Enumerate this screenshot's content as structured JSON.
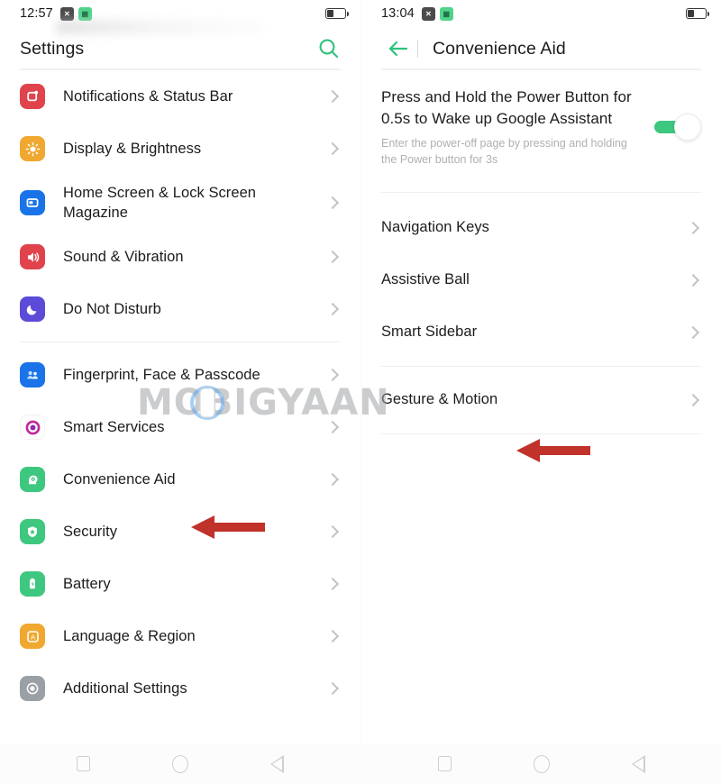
{
  "left_panel": {
    "status_bar": {
      "time": "12:57",
      "icons": [
        "app-icon-dark",
        "app-icon-green"
      ],
      "battery_level_percent": 38
    },
    "header": {
      "title": "Settings",
      "search_icon": "search-icon"
    },
    "list": [
      {
        "label": "Notifications & Status Bar",
        "icon": "bell-icon",
        "icon_color": "#e0434b",
        "chevron": "chevron-right-icon",
        "divider_after": false
      },
      {
        "label": "Display & Brightness",
        "icon": "brightness-icon",
        "icon_color": "#f0a830",
        "chevron": "chevron-right-icon",
        "divider_after": false
      },
      {
        "label": "Home Screen & Lock Screen Magazine",
        "icon": "home-screen-icon",
        "icon_color": "#1a73e8",
        "chevron": "chevron-right-icon",
        "divider_after": false
      },
      {
        "label": "Sound & Vibration",
        "icon": "speaker-icon",
        "icon_color": "#e0434b",
        "chevron": "chevron-right-icon",
        "divider_after": false
      },
      {
        "label": "Do Not Disturb",
        "icon": "moon-icon",
        "icon_color": "#5b4bd6",
        "chevron": "chevron-right-icon",
        "divider_after": true
      },
      {
        "label": "Fingerprint, Face & Passcode",
        "icon": "fingerprint-face-icon",
        "icon_color": "#1a73e8",
        "chevron": "chevron-right-icon",
        "divider_after": false
      },
      {
        "label": "Smart Services",
        "icon": "smart-services-icon",
        "icon_color": "#ffffff",
        "chevron": "chevron-right-icon",
        "divider_after": false
      },
      {
        "label": "Convenience Aid",
        "icon": "head-brain-icon",
        "icon_color": "#3ec77f",
        "chevron": "chevron-right-icon",
        "divider_after": false
      },
      {
        "label": "Security",
        "icon": "shield-icon",
        "icon_color": "#3ec77f",
        "chevron": "chevron-right-icon",
        "divider_after": false
      },
      {
        "label": "Battery",
        "icon": "battery-icon",
        "icon_color": "#3ec77f",
        "chevron": "chevron-right-icon",
        "divider_after": false
      },
      {
        "label": "Language & Region",
        "icon": "language-a-icon",
        "icon_color": "#f0a830",
        "chevron": "chevron-right-icon",
        "divider_after": false
      },
      {
        "label": "Additional Settings",
        "icon": "additional-settings-icon",
        "icon_color": "#9aa0a6",
        "chevron": "chevron-right-icon",
        "divider_after": false
      }
    ],
    "nav_bar": [
      "recents-square-icon",
      "home-circle-icon",
      "back-triangle-icon"
    ]
  },
  "right_panel": {
    "status_bar": {
      "time": "13:04",
      "icons": [
        "app-icon-dark",
        "app-icon-green"
      ],
      "battery_level_percent": 38
    },
    "header": {
      "back_icon": "back-arrow-icon",
      "title": "Convenience Aid"
    },
    "power_toggle": {
      "title": "Press and Hold the Power Button for 0.5s to Wake up Google Assistant",
      "subtitle": "Enter the power-off page by pressing and holding the Power button for 3s",
      "state": "on",
      "track_color": "#3ec77f"
    },
    "list": [
      {
        "label": "Navigation Keys",
        "chevron": "chevron-right-icon"
      },
      {
        "label": "Assistive Ball",
        "chevron": "chevron-right-icon"
      },
      {
        "label": "Smart Sidebar",
        "chevron": "chevron-right-icon"
      },
      {
        "label": "Gesture & Motion",
        "chevron": "chevron-right-icon"
      }
    ],
    "nav_bar": [
      "recents-square-icon",
      "home-circle-icon",
      "back-triangle-icon"
    ]
  },
  "annotations": {
    "arrow_color": "#c0322a",
    "arrows": [
      {
        "points_to": "Convenience Aid"
      },
      {
        "points_to": "Gesture & Motion"
      }
    ]
  },
  "watermark": {
    "text": "MOBIGYAAN",
    "color": "#a0a2a6"
  }
}
